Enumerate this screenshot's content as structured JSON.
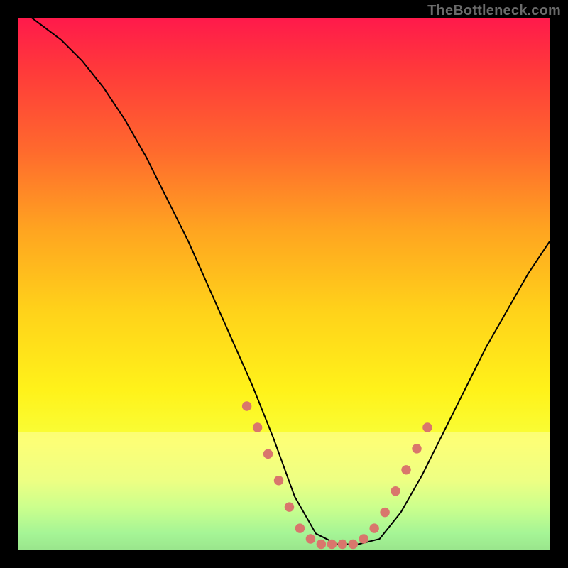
{
  "watermark": {
    "text": "TheBottleneck.com"
  },
  "chart_data": {
    "type": "line",
    "title": "",
    "xlabel": "",
    "ylabel": "",
    "xlim": [
      0,
      100
    ],
    "ylim": [
      0,
      100
    ],
    "curve": {
      "x": [
        0,
        4,
        8,
        12,
        16,
        20,
        24,
        28,
        32,
        36,
        40,
        44,
        48,
        52,
        56,
        60,
        64,
        68,
        72,
        76,
        80,
        84,
        88,
        92,
        96,
        100
      ],
      "y": [
        102,
        99,
        96,
        92,
        87,
        81,
        74,
        66,
        58,
        49,
        40,
        31,
        21,
        10,
        3,
        1,
        1,
        2,
        7,
        14,
        22,
        30,
        38,
        45,
        52,
        58
      ]
    },
    "highlight_points": {
      "x": [
        43,
        45,
        47,
        49,
        51,
        53,
        55,
        57,
        59,
        61,
        63,
        65,
        67,
        69,
        71,
        73,
        75,
        77
      ],
      "y": [
        27,
        23,
        18,
        13,
        8,
        4,
        2,
        1,
        1,
        1,
        1,
        2,
        4,
        7,
        11,
        15,
        19,
        23
      ]
    },
    "bright_band": {
      "y_bottom": 0,
      "y_top": 22
    },
    "colors": {
      "point_fill": "#d9766c",
      "curve_stroke": "#000000",
      "gradient_top": "#ff1a4b",
      "gradient_bottom": "#20c76a"
    }
  }
}
